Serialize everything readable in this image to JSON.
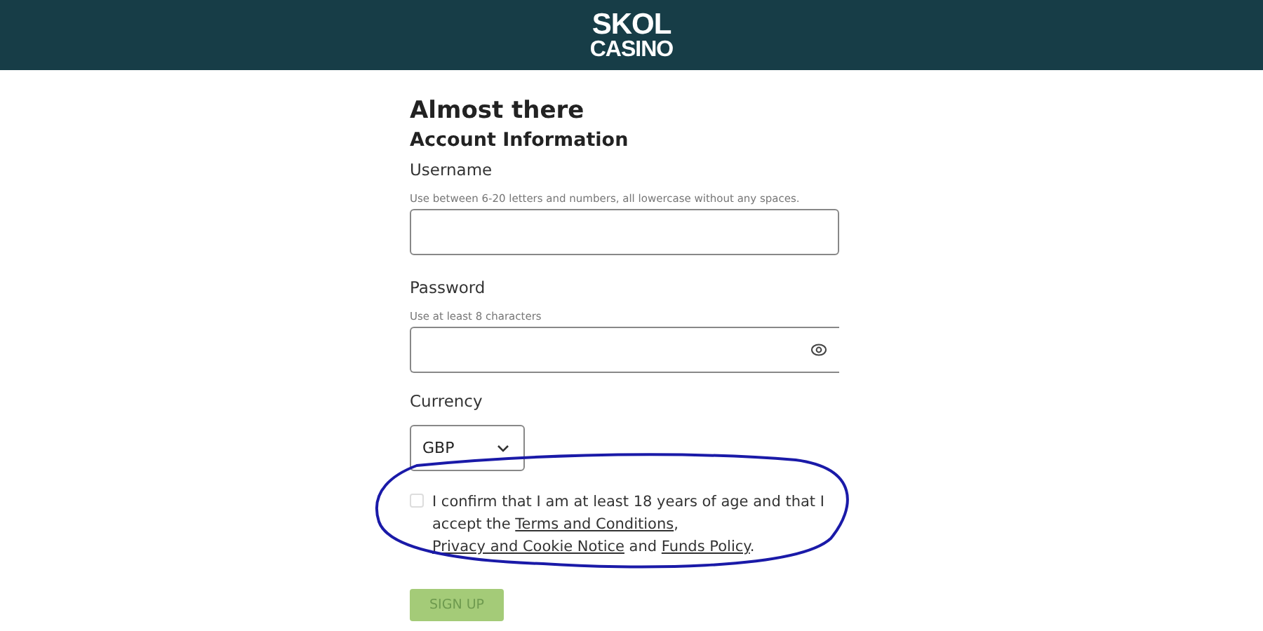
{
  "header": {
    "logo_lines": [
      "SKOL",
      "CASINO"
    ]
  },
  "title": "Almost there",
  "section": "Account Information",
  "username": {
    "label": "Username",
    "hint": "Use between 6-20 letters and numbers, all lowercase without any spaces."
  },
  "password": {
    "label": "Password",
    "hint": "Use at least 8 characters"
  },
  "currency": {
    "label": "Currency",
    "value": "GBP"
  },
  "consent": {
    "checked": false,
    "parts": [
      {
        "kind": "text",
        "text": "I confirm that I am at least 18 years of age and that I accept the "
      },
      {
        "kind": "link",
        "text": "Terms and Conditions"
      },
      {
        "kind": "text",
        "text": ", "
      },
      {
        "kind": "link",
        "text": "Privacy and Cookie Notice"
      },
      {
        "kind": "text",
        "text": " and "
      },
      {
        "kind": "link",
        "text": "Funds Policy"
      },
      {
        "kind": "text",
        "text": "."
      }
    ]
  },
  "signup": {
    "label": "SIGN UP",
    "disabled": true
  }
}
